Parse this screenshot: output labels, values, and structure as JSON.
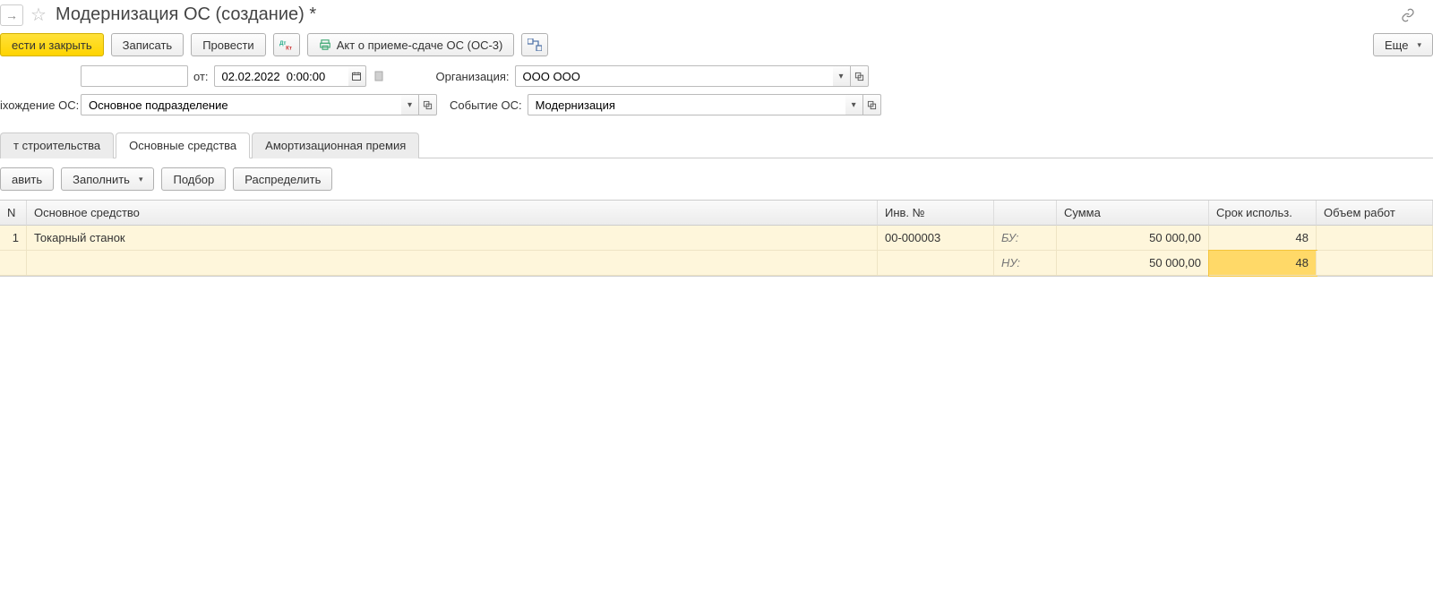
{
  "title": "Модернизация ОС (создание) *",
  "toolbar": {
    "post_and_close": "ести и закрыть",
    "write": "Записать",
    "post": "Провести",
    "act_os3": "Акт о приеме-сдаче ОС (ОС-3)",
    "more": "Еще"
  },
  "form": {
    "ot_label": "от:",
    "number": "",
    "date": "02.02.2022  0:00:00",
    "org_label": "Организация:",
    "org_value": "ООО ООО",
    "loc_label": "іхождение ОС:",
    "loc_value": "Основное подразделение",
    "event_label": "Событие ОС:",
    "event_value": "Модернизация"
  },
  "tabs": {
    "t1": "т строительства",
    "t2": "Основные средства",
    "t3": "Амортизационная премия"
  },
  "tab_toolbar": {
    "add": "авить",
    "fill": "Заполнить",
    "pick": "Подбор",
    "dist": "Распределить"
  },
  "cols": {
    "n": "N",
    "asset": "Основное средство",
    "inv": "Инв. №",
    "type": "",
    "sum": "Сумма",
    "term": "Срок использ.",
    "work": "Объем работ"
  },
  "rows": [
    {
      "n": "1",
      "asset": "Токарный станок",
      "inv": "00-000003",
      "bu_label": "БУ:",
      "nu_label": "НУ:",
      "sum_bu": "50 000,00",
      "sum_nu": "50 000,00",
      "term_bu": "48",
      "term_nu": "48"
    }
  ]
}
